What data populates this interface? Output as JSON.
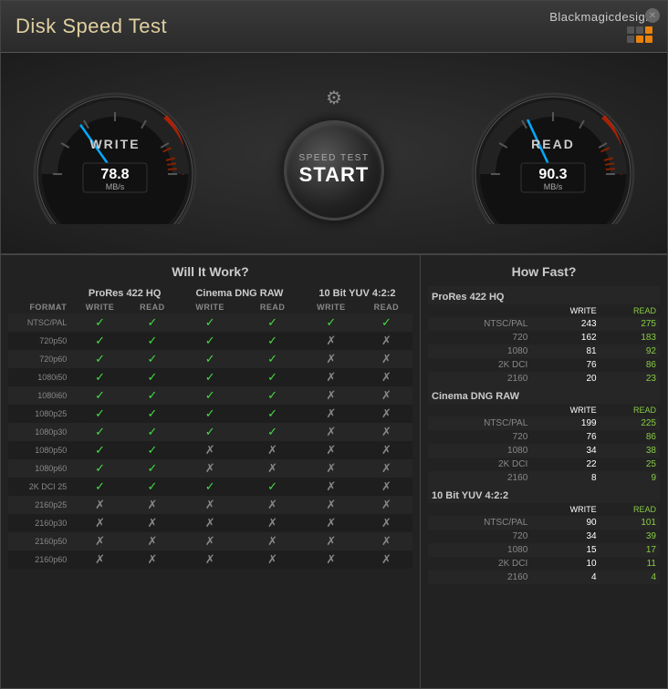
{
  "app": {
    "title": "Disk Speed Test",
    "brand": "Blackmagicdesign"
  },
  "gauges": {
    "write": {
      "label": "WRITE",
      "value": "78.8",
      "unit": "MB/s"
    },
    "read": {
      "label": "READ",
      "value": "90.3",
      "unit": "MB/s"
    }
  },
  "start_button": {
    "top": "SPEED TEST",
    "main": "START"
  },
  "will_it_work": {
    "title": "Will It Work?",
    "columns": [
      "FORMAT",
      "ProRes 422 HQ",
      "",
      "Cinema DNG RAW",
      "",
      "10 Bit YUV 4:2:2",
      ""
    ],
    "sub_columns": [
      "",
      "WRITE",
      "READ",
      "WRITE",
      "READ",
      "WRITE",
      "READ"
    ],
    "rows": [
      [
        "NTSC/PAL",
        "✓",
        "✓",
        "✓",
        "✓",
        "✓",
        "✓"
      ],
      [
        "720p50",
        "✓",
        "✓",
        "✓",
        "✓",
        "✗",
        "✗"
      ],
      [
        "720p60",
        "✓",
        "✓",
        "✓",
        "✓",
        "✗",
        "✗"
      ],
      [
        "1080i50",
        "✓",
        "✓",
        "✓",
        "✓",
        "✗",
        "✗"
      ],
      [
        "1080i60",
        "✓",
        "✓",
        "✓",
        "✓",
        "✗",
        "✗"
      ],
      [
        "1080p25",
        "✓",
        "✓",
        "✓",
        "✓",
        "✗",
        "✗"
      ],
      [
        "1080p30",
        "✓",
        "✓",
        "✓",
        "✓",
        "✗",
        "✗"
      ],
      [
        "1080p50",
        "✓",
        "✓",
        "✗",
        "✗",
        "✗",
        "✗"
      ],
      [
        "1080p60",
        "✓",
        "✓",
        "✗",
        "✗",
        "✗",
        "✗"
      ],
      [
        "2K DCI 25",
        "✓",
        "✓",
        "✓",
        "✓",
        "✗",
        "✗"
      ],
      [
        "2160p25",
        "✗",
        "✗",
        "✗",
        "✗",
        "✗",
        "✗"
      ],
      [
        "2160p30",
        "✗",
        "✗",
        "✗",
        "✗",
        "✗",
        "✗"
      ],
      [
        "2160p50",
        "✗",
        "✗",
        "✗",
        "✗",
        "✗",
        "✗"
      ],
      [
        "2160p60",
        "✗",
        "✗",
        "✗",
        "✗",
        "✗",
        "✗"
      ]
    ]
  },
  "how_fast": {
    "title": "How Fast?",
    "sections": [
      {
        "name": "ProRes 422 HQ",
        "rows": [
          [
            "NTSC/PAL",
            "243",
            "275"
          ],
          [
            "720",
            "162",
            "183"
          ],
          [
            "1080",
            "81",
            "92"
          ],
          [
            "2K DCI",
            "76",
            "86"
          ],
          [
            "2160",
            "20",
            "23"
          ]
        ]
      },
      {
        "name": "Cinema DNG RAW",
        "rows": [
          [
            "NTSC/PAL",
            "199",
            "225"
          ],
          [
            "720",
            "76",
            "86"
          ],
          [
            "1080",
            "34",
            "38"
          ],
          [
            "2K DCI",
            "22",
            "25"
          ],
          [
            "2160",
            "8",
            "9"
          ]
        ]
      },
      {
        "name": "10 Bit YUV 4:2:2",
        "rows": [
          [
            "NTSC/PAL",
            "90",
            "101"
          ],
          [
            "720",
            "34",
            "39"
          ],
          [
            "1080",
            "15",
            "17"
          ],
          [
            "2K DCI",
            "10",
            "11"
          ],
          [
            "2160",
            "4",
            "4"
          ]
        ]
      }
    ]
  },
  "colors": {
    "check": "#44dd44",
    "cross": "#666",
    "read_value": "#88cc44",
    "write_value": "#ffffff",
    "needle": "#00aaff"
  }
}
